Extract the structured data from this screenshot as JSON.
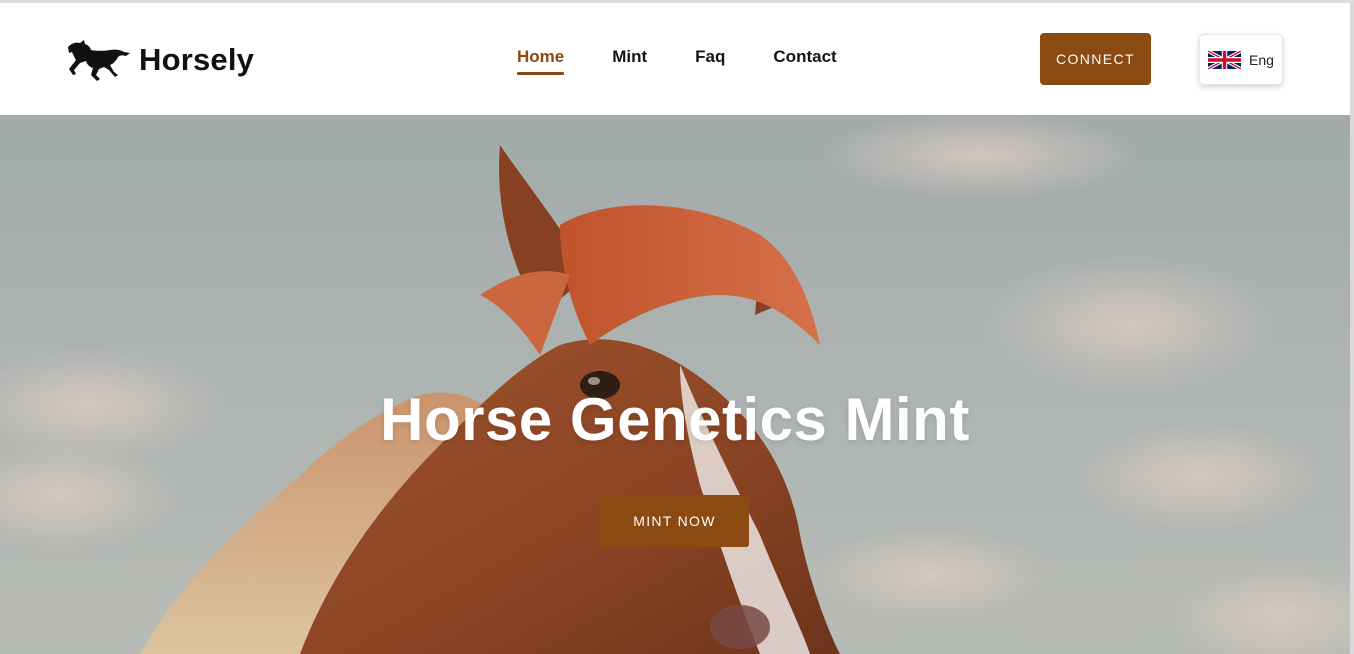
{
  "header": {
    "brand": "Horsely",
    "nav": [
      {
        "label": "Home",
        "active": true
      },
      {
        "label": "Mint",
        "active": false
      },
      {
        "label": "Faq",
        "active": false
      },
      {
        "label": "Contact",
        "active": false
      }
    ],
    "connect_label": "CONNECT",
    "language": {
      "label": "Eng",
      "flag_icon": "uk-flag-icon"
    }
  },
  "hero": {
    "title": "Horse Genetics Mint",
    "cta_label": "MINT NOW"
  },
  "colors": {
    "accent": "#8a4a12",
    "nav_text": "#151515",
    "hero_text": "#ffffff"
  }
}
